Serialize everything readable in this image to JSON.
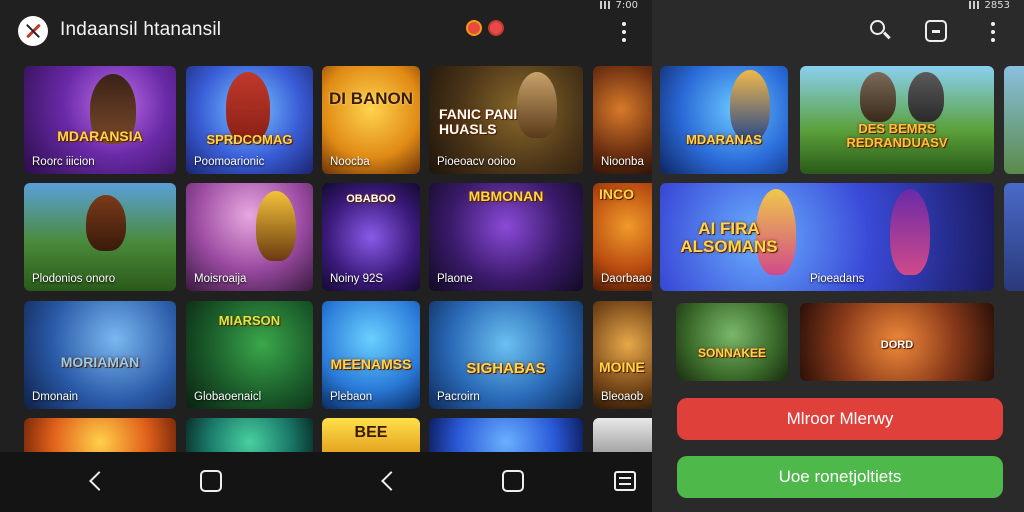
{
  "left_panel": {
    "app_title": "Indaansil htanansil",
    "status_time": "7:00",
    "tiles": [
      {
        "title": "MDARANSIA",
        "caption": "Roorc  iiicion"
      },
      {
        "title": "SPRDCOMAG",
        "caption": "Poomoarionic"
      },
      {
        "title": "DI BANON",
        "caption": "Noocba"
      },
      {
        "title": "FANIC PANI HUASLS",
        "caption": "Pioeoacv  ooioo"
      },
      {
        "title": "",
        "caption": "Nioonba"
      },
      {
        "title": "",
        "caption": "Plodonios  onoro"
      },
      {
        "title": "",
        "caption": "Moisroaija"
      },
      {
        "title": "OBABOO",
        "caption": "Noiny 92S"
      },
      {
        "title": "MBMONAN",
        "caption": "Plaone"
      },
      {
        "title": "INCO",
        "caption": "Daorbaaoion"
      },
      {
        "title": "MORIAMAN",
        "caption": "Dmonain"
      },
      {
        "title": "MIARSON",
        "caption": "Globaoenaicl"
      },
      {
        "title": "MEENAMSS",
        "caption": "Plebaon"
      },
      {
        "title": "SIGHABAS",
        "caption": "Pacroirn"
      },
      {
        "title": "MOINE",
        "caption": "Bleoaob"
      },
      {
        "title": "",
        "caption": ""
      },
      {
        "title": "",
        "caption": ""
      },
      {
        "title": "BEE",
        "caption": ""
      },
      {
        "title": "",
        "caption": ""
      },
      {
        "title": "",
        "caption": ""
      }
    ]
  },
  "right_panel": {
    "status_time": "2853",
    "tiles": [
      {
        "title": "MDARANAS",
        "caption": ""
      },
      {
        "title": "DES BEMRS REDRANDUASV",
        "caption": ""
      },
      {
        "title": "AI FIRA ALSOMANS",
        "caption": "Pioeadans"
      },
      {
        "title": "SONNAKEE",
        "caption": ""
      },
      {
        "title": "DORD",
        "caption": ""
      }
    ],
    "primary_button": "Mlroor Mlerwy",
    "secondary_button": "Uoe ronetjoltiets"
  },
  "colors": {
    "accent_red": "#e0403a",
    "accent_green": "#4fb84a"
  }
}
